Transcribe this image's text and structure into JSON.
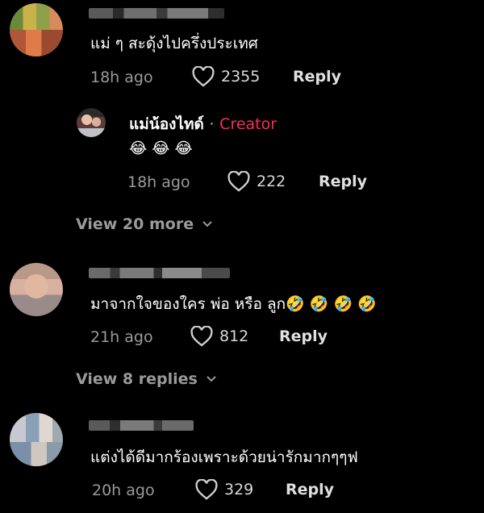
{
  "colors": {
    "background": "#000000",
    "creator_tag": "#fe2c55",
    "meta": "#9a9a9a"
  },
  "comments": [
    {
      "text": "แม่ ๆ สะดุ้งไปครึ่งประเทศ",
      "time": "18h ago",
      "likes": "2355",
      "reply_label": "Reply",
      "reply": {
        "author": "แม่น้องไทด์",
        "separator": "·",
        "badge": "Creator",
        "text": "😂 😂 😂",
        "time": "18h ago",
        "likes": "222",
        "reply_label": "Reply"
      },
      "view_more": "View 20 more"
    },
    {
      "text": "มาจากใจของใคร พ่อ หรือ ลูก🤣 🤣 🤣 🤣",
      "time": "21h ago",
      "likes": "812",
      "reply_label": "Reply",
      "view_more": "View 8 replies"
    },
    {
      "text": "แต่งได้ดีมากร้องเพราะด้วยน่ารักมากๆๆฟ",
      "time": "20h ago",
      "likes": "329",
      "reply_label": "Reply"
    }
  ],
  "icons": {
    "like": "heart-outline-icon",
    "expand": "chevron-down-icon"
  }
}
